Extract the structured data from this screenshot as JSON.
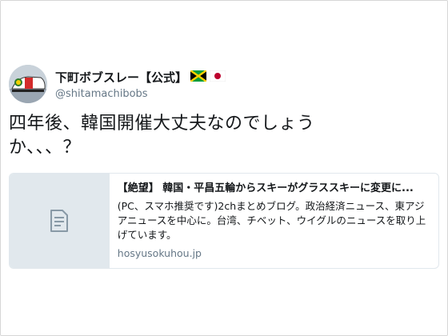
{
  "tweet": {
    "display_name": "下町ボブスレー【公式】",
    "handle": "@shitamachibobs",
    "flags": [
      "jamaica-flag-icon",
      "japan-flag-icon"
    ],
    "text": "四年後、韓国開催大丈夫なのでしょうか、、、？"
  },
  "card": {
    "title": "【絶望】 韓国・平昌五輪からスキーがグラススキーに変更に...",
    "description": "(PC、スマホ推奨です)2chまとめブログ。政治経済ニュース、東アジアニュースを中心に。台湾、チベット、ウイグルのニュースを取り上げています。",
    "domain": "hosyusokuhou.jp",
    "thumbnail_icon": "document-icon"
  },
  "colors": {
    "text": "#14171a",
    "secondary": "#657786",
    "card_border": "#e1e8ed",
    "thumb_bg": "#e1e8ed"
  }
}
